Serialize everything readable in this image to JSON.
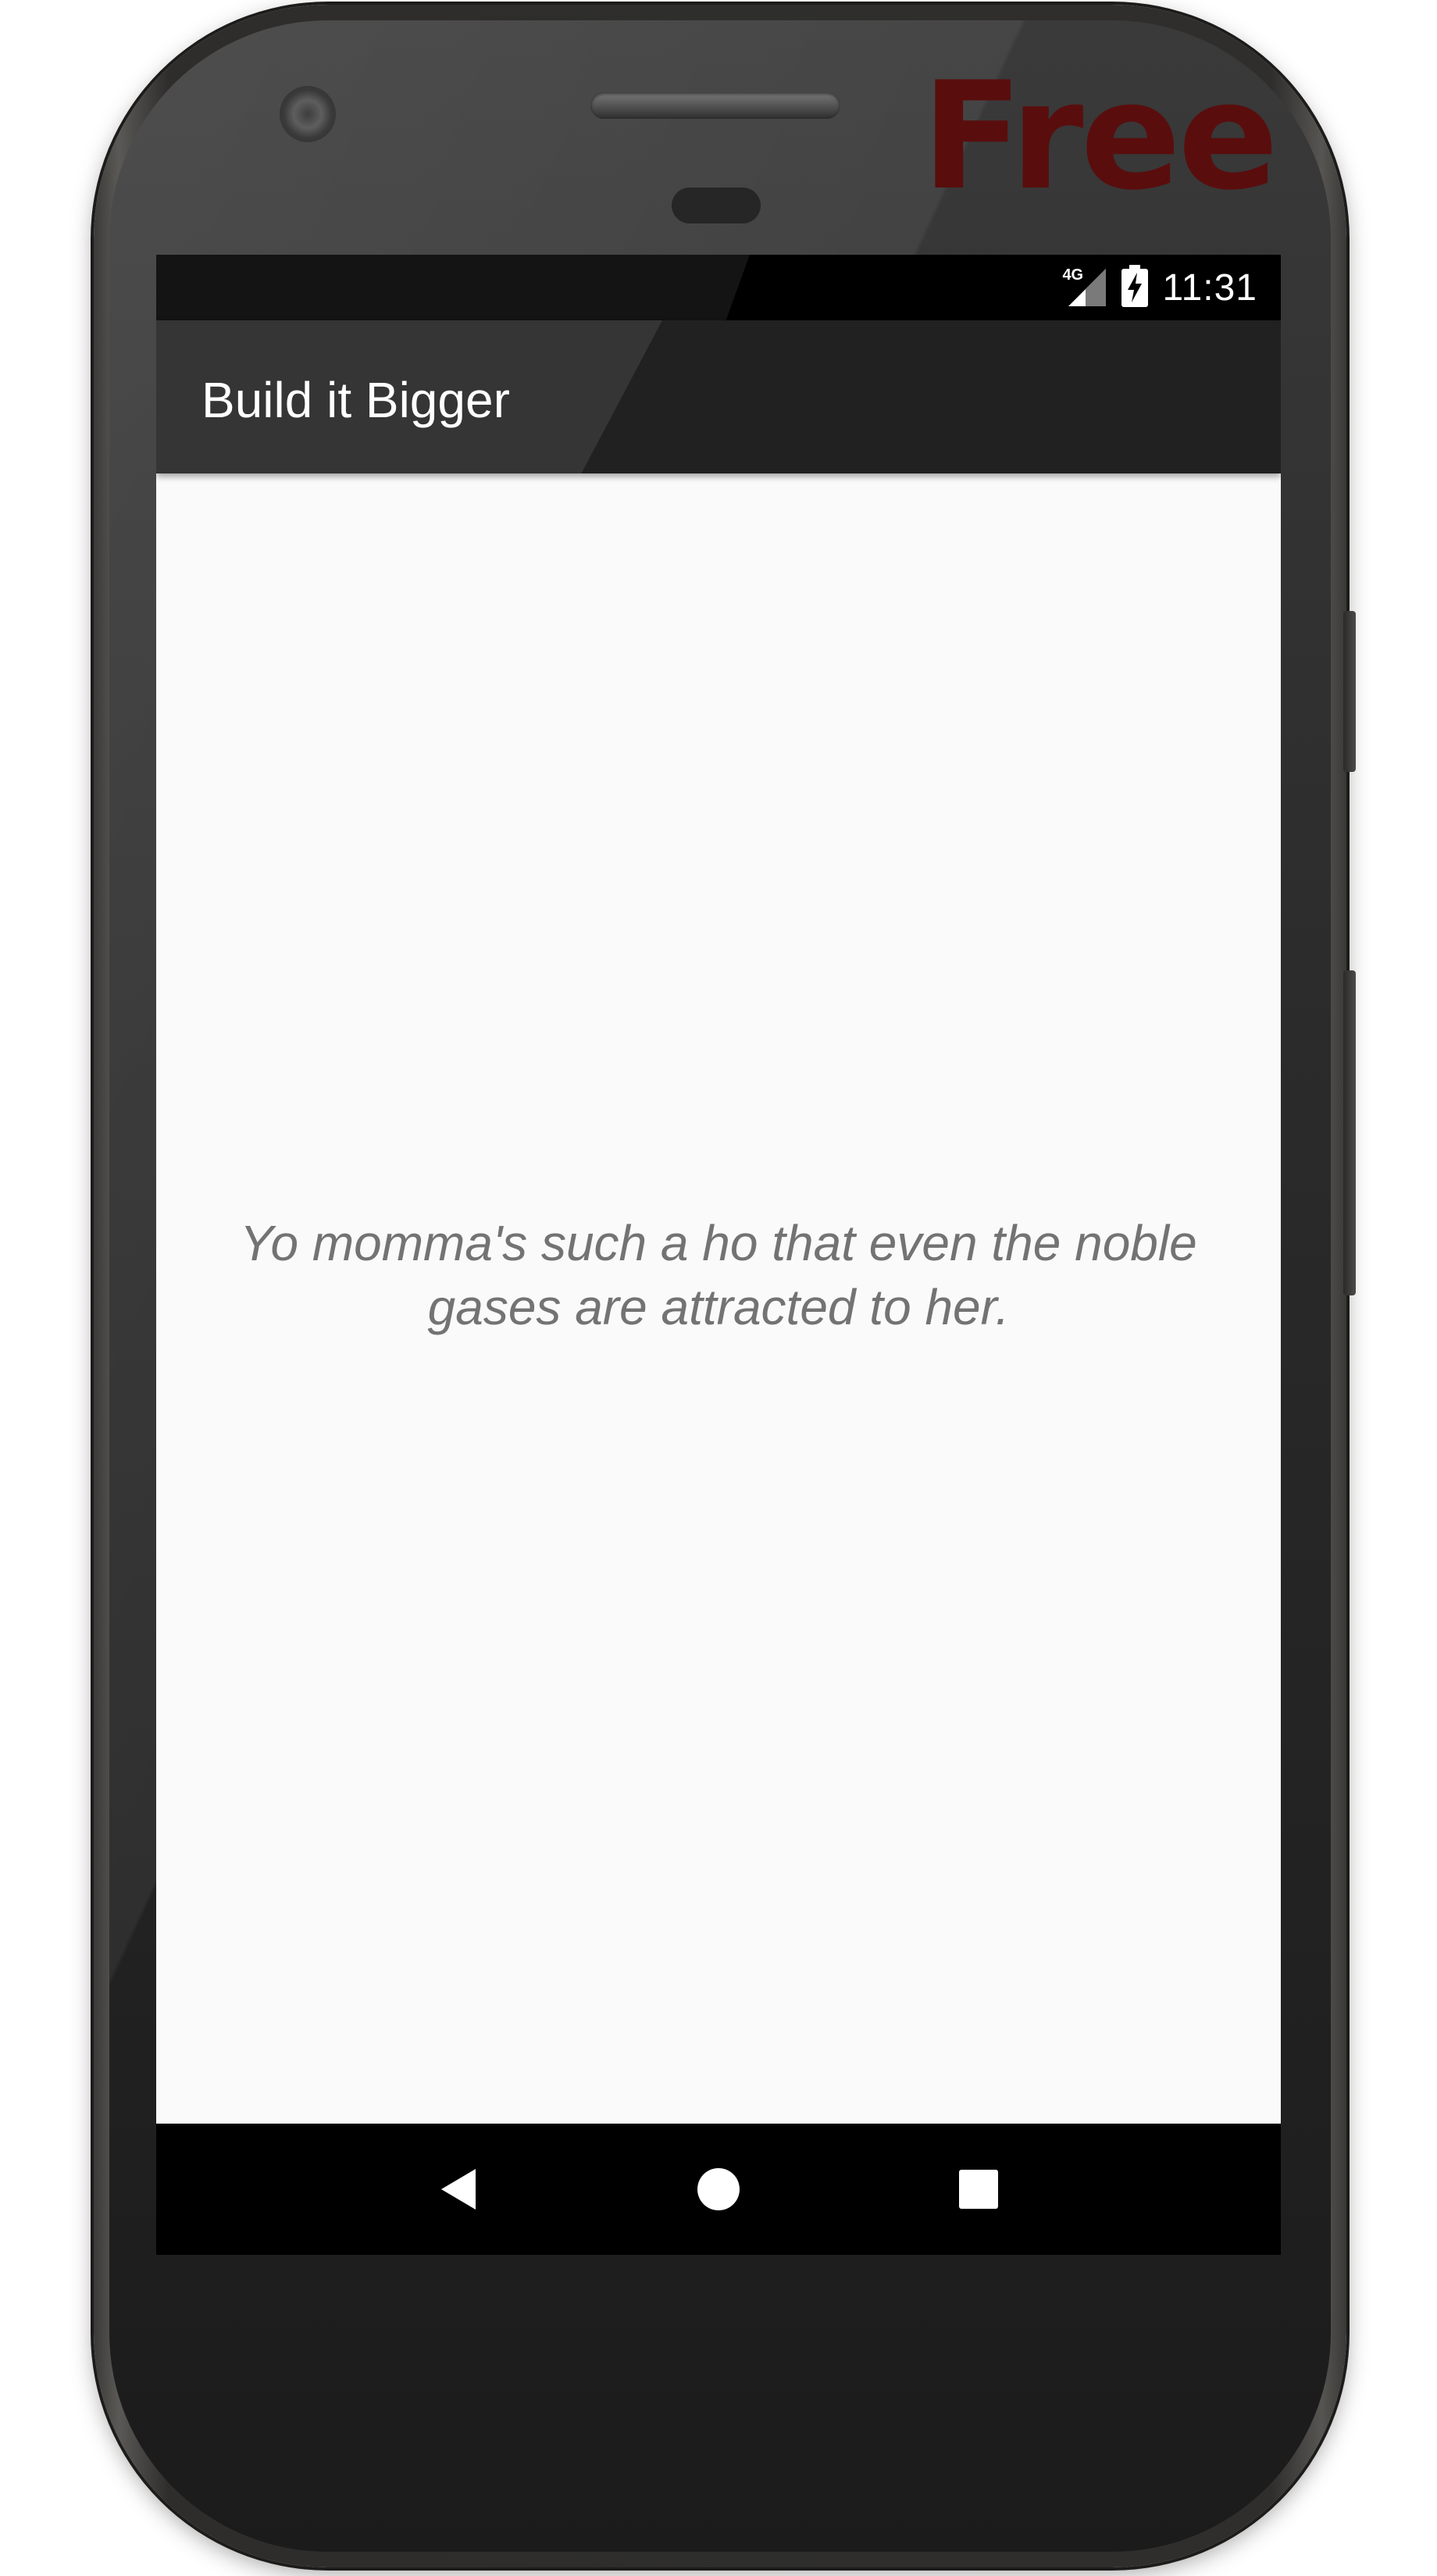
{
  "device": {
    "badge": "Free",
    "badge_color": "#5a0d0d"
  },
  "status_bar": {
    "network_type": "4G",
    "signal_icon": "cell-signal-icon",
    "battery_icon": "battery-charging-icon",
    "time": "11:31"
  },
  "app_bar": {
    "title": "Build it Bigger",
    "background": "#212121"
  },
  "content": {
    "joke": "Yo momma's such a ho that even the noble gases are attracted to her.",
    "text_color": "#737373"
  },
  "nav_bar": {
    "back_icon": "back-triangle-icon",
    "home_icon": "home-circle-icon",
    "recents_icon": "recents-square-icon"
  }
}
